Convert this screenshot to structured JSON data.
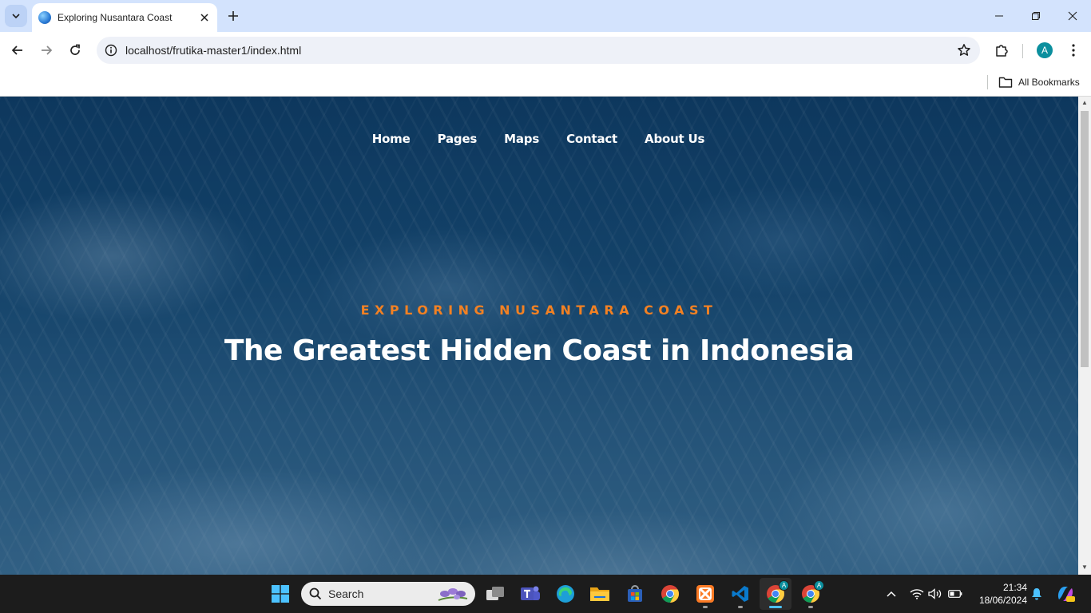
{
  "browser": {
    "tab": {
      "title": "Exploring Nusantara Coast"
    },
    "url": "localhost/frutika-master1/index.html",
    "profile_initial": "A",
    "bookmarks": {
      "all_label": "All Bookmarks"
    }
  },
  "site": {
    "nav": [
      "Home",
      "Pages",
      "Maps",
      "Contact",
      "About Us"
    ],
    "hero": {
      "subtitle": "EXPLORING NUSANTARA COAST",
      "title": "The Greatest Hidden Coast in Indonesia"
    },
    "colors": {
      "accent": "#f28123",
      "nav_text": "#ffffff"
    }
  },
  "taskbar": {
    "search_placeholder": "Search",
    "time": "21:34",
    "date": "18/06/2024",
    "chrome_badge": "A"
  }
}
